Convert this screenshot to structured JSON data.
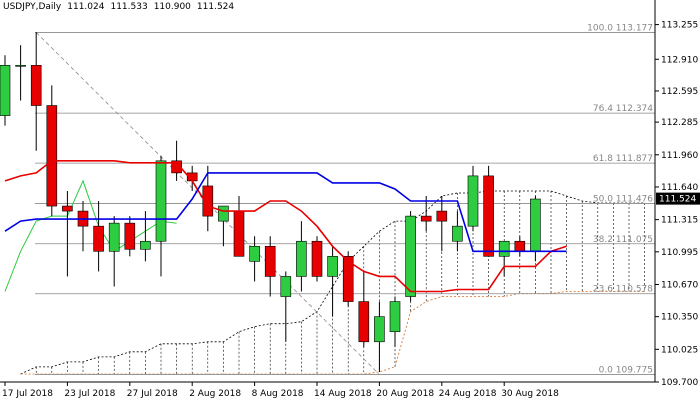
{
  "header": {
    "symbol": "USDJPY,Daily",
    "open": "111.024",
    "high": "111.533",
    "low": "110.900",
    "close": "111.524"
  },
  "colors": {
    "bull": "#2ecc40",
    "bear": "#e60000",
    "tenkan": "#e60000",
    "kijun": "#0000e6",
    "chikou": "#2ecc40",
    "cloud": "#000000",
    "fib": "#888888",
    "price_tag_bg": "#000000",
    "price_tag_fg": "#ffffff"
  },
  "chart_data": {
    "type": "candlestick",
    "title": "USDJPY,Daily",
    "ylim": [
      109.7,
      113.42
    ],
    "y_ticks": [
      "113.255",
      "112.910",
      "112.595",
      "112.285",
      "111.960",
      "111.640",
      "111.315",
      "110.995",
      "110.670",
      "110.350",
      "110.025",
      "109.700"
    ],
    "x_ticks": [
      "17 Jul 2018",
      "23 Jul 2018",
      "27 Jul 2018",
      "2 Aug 2018",
      "8 Aug 2018",
      "14 Aug 2018",
      "20 Aug 2018",
      "24 Aug 2018",
      "30 Aug 2018"
    ],
    "current_price": "111.524",
    "candles": [
      {
        "o": 112.35,
        "h": 112.95,
        "l": 112.25,
        "c": 112.85
      },
      {
        "o": 112.85,
        "h": 113.05,
        "l": 112.5,
        "c": 112.85
      },
      {
        "o": 112.85,
        "h": 113.18,
        "l": 112.0,
        "c": 112.45
      },
      {
        "o": 112.45,
        "h": 112.65,
        "l": 111.35,
        "c": 111.45
      },
      {
        "o": 111.45,
        "h": 111.6,
        "l": 110.75,
        "c": 111.4
      },
      {
        "o": 111.4,
        "h": 111.5,
        "l": 111.0,
        "c": 111.25
      },
      {
        "o": 111.25,
        "h": 111.5,
        "l": 110.8,
        "c": 111.0
      },
      {
        "o": 111.0,
        "h": 111.35,
        "l": 110.65,
        "c": 111.28
      },
      {
        "o": 111.28,
        "h": 111.35,
        "l": 110.95,
        "c": 111.02
      },
      {
        "o": 111.02,
        "h": 111.4,
        "l": 110.9,
        "c": 111.1
      },
      {
        "o": 111.1,
        "h": 111.95,
        "l": 110.75,
        "c": 111.9
      },
      {
        "o": 111.9,
        "h": 112.1,
        "l": 111.7,
        "c": 111.78
      },
      {
        "o": 111.78,
        "h": 111.85,
        "l": 111.6,
        "c": 111.7
      },
      {
        "o": 111.65,
        "h": 111.85,
        "l": 111.2,
        "c": 111.35
      },
      {
        "o": 111.3,
        "h": 111.45,
        "l": 111.05,
        "c": 111.45
      },
      {
        "o": 111.4,
        "h": 111.55,
        "l": 110.95,
        "c": 110.95
      },
      {
        "o": 110.9,
        "h": 111.15,
        "l": 110.7,
        "c": 111.05
      },
      {
        "o": 111.05,
        "h": 111.15,
        "l": 110.55,
        "c": 110.75
      },
      {
        "o": 110.55,
        "h": 110.8,
        "l": 110.1,
        "c": 110.75
      },
      {
        "o": 110.75,
        "h": 111.3,
        "l": 110.6,
        "c": 111.1
      },
      {
        "o": 111.1,
        "h": 111.15,
        "l": 110.7,
        "c": 110.75
      },
      {
        "o": 110.75,
        "h": 111.05,
        "l": 110.35,
        "c": 110.95
      },
      {
        "o": 110.95,
        "h": 111.0,
        "l": 110.45,
        "c": 110.5
      },
      {
        "o": 110.5,
        "h": 110.8,
        "l": 110.05,
        "c": 110.1
      },
      {
        "o": 110.1,
        "h": 110.5,
        "l": 109.8,
        "c": 110.35
      },
      {
        "o": 110.2,
        "h": 110.55,
        "l": 110.05,
        "c": 110.5
      },
      {
        "o": 110.55,
        "h": 111.4,
        "l": 110.5,
        "c": 111.35
      },
      {
        "o": 111.35,
        "h": 111.55,
        "l": 111.2,
        "c": 111.3
      },
      {
        "o": 111.4,
        "h": 111.55,
        "l": 111.0,
        "c": 111.3
      },
      {
        "o": 111.1,
        "h": 111.4,
        "l": 111.0,
        "c": 111.25
      },
      {
        "o": 111.25,
        "h": 111.85,
        "l": 111.2,
        "c": 111.75
      },
      {
        "o": 111.75,
        "h": 111.85,
        "l": 110.95,
        "c": 110.95
      },
      {
        "o": 110.95,
        "h": 111.1,
        "l": 110.75,
        "c": 111.1
      },
      {
        "o": 111.1,
        "h": 111.15,
        "l": 110.95,
        "c": 111.0
      },
      {
        "o": 111.0,
        "h": 111.55,
        "l": 110.9,
        "c": 111.52
      }
    ],
    "tenkan_sen": [
      111.7,
      111.75,
      111.78,
      111.9,
      111.9,
      111.9,
      111.9,
      111.9,
      111.88,
      111.88,
      111.88,
      111.88,
      111.7,
      111.45,
      111.4,
      111.4,
      111.4,
      111.5,
      111.5,
      111.4,
      111.25,
      111.05,
      110.9,
      110.8,
      110.75,
      110.75,
      110.6,
      110.6,
      110.6,
      110.62,
      110.62,
      110.62,
      110.85,
      110.85,
      110.85,
      111.0,
      111.05
    ],
    "kijun_sen": [
      111.2,
      111.3,
      111.32,
      111.32,
      111.32,
      111.32,
      111.32,
      111.32,
      111.32,
      111.32,
      111.32,
      111.32,
      111.52,
      111.78,
      111.78,
      111.78,
      111.78,
      111.78,
      111.78,
      111.78,
      111.78,
      111.68,
      111.68,
      111.68,
      111.68,
      111.62,
      111.5,
      111.5,
      111.5,
      111.5,
      111.0,
      111.0,
      111.0,
      111.0,
      111.0,
      111.0,
      111.0
    ],
    "chikou_span": [
      110.6,
      111.0,
      111.3,
      111.35,
      111.35,
      111.7,
      111.25,
      111.0,
      111.1,
      111.2,
      111.3,
      111.28
    ],
    "cloud_span_a": [
      109.78,
      109.85,
      109.85,
      109.9,
      109.9,
      109.95,
      109.95,
      110.0,
      110.0,
      110.08,
      110.08,
      110.08,
      110.1,
      110.1,
      110.2,
      110.25,
      110.28,
      110.28,
      110.3,
      110.4,
      110.65,
      110.9,
      111.05,
      111.2,
      111.3,
      111.3,
      111.4,
      111.55,
      111.58,
      111.58,
      111.6,
      111.6,
      111.6,
      111.6,
      111.6,
      111.55,
      111.5,
      111.48,
      111.48,
      111.48,
      111.48,
      111.48,
      111.48
    ],
    "cloud_span_b": [
      109.78,
      109.78,
      109.78,
      109.78,
      109.78,
      109.78,
      109.78,
      109.78,
      109.78,
      109.78,
      109.78,
      109.78,
      109.78,
      109.78,
      109.78,
      109.78,
      109.78,
      109.78,
      109.78,
      109.78,
      109.78,
      109.78,
      109.78,
      109.8,
      109.85,
      110.4,
      110.5,
      110.55,
      110.55,
      110.55,
      110.55,
      110.55,
      110.58,
      110.58,
      110.58,
      110.6,
      110.6,
      110.6,
      110.6,
      110.6,
      110.6,
      110.6,
      110.6
    ],
    "fib_levels": [
      {
        "label": "100.0 113.177",
        "value": 113.177
      },
      {
        "label": "76.4 112.374",
        "value": 112.374
      },
      {
        "label": "61.8 111.877",
        "value": 111.877
      },
      {
        "label": "50.0 111.476",
        "value": 111.476
      },
      {
        "label": "38.2 111.075",
        "value": 111.075
      },
      {
        "label": "23.6 110.578",
        "value": 110.578
      },
      {
        "label": "0.0 109.775",
        "value": 109.775
      }
    ],
    "fib_trend": {
      "from": {
        "bar": 2,
        "value": 113.177
      },
      "to": {
        "bar": 24,
        "value": 109.775
      }
    }
  }
}
